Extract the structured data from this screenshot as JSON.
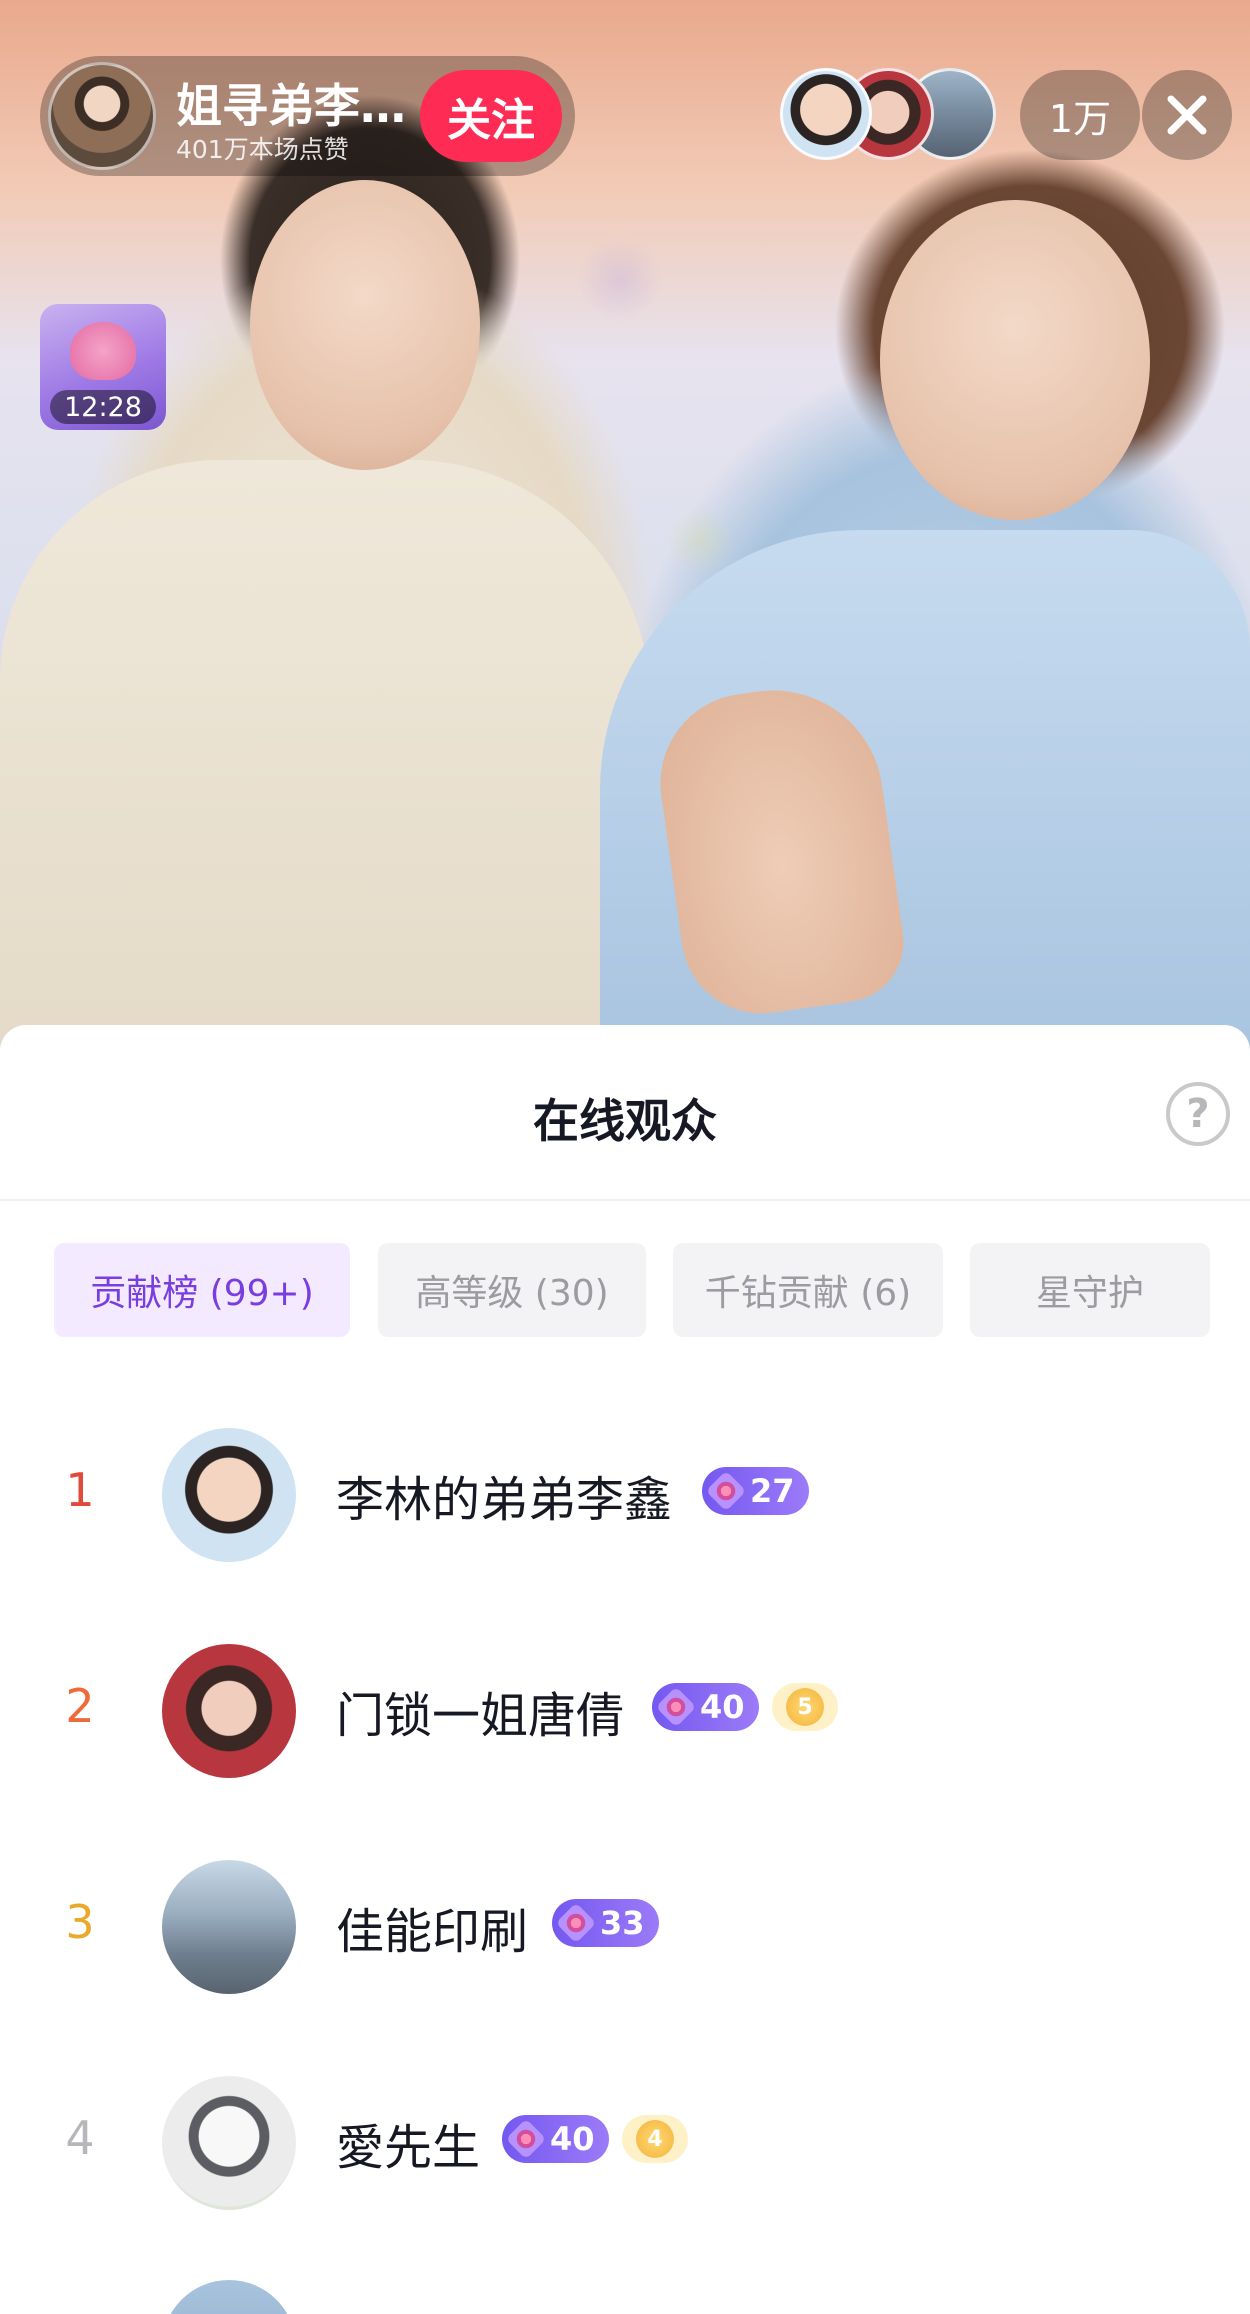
{
  "live": {
    "host_name": "姐寻弟李…",
    "likes_text": "401万本场点赞",
    "follow_label": "关注",
    "viewer_count": "1万",
    "gift_timer": "12:28"
  },
  "sheet": {
    "title": "在线观众",
    "help_symbol": "?",
    "tabs": [
      {
        "label": "贡献榜 (99+)",
        "active": true
      },
      {
        "label": "高等级 (30)",
        "active": false
      },
      {
        "label": "千钻贡献 (6)",
        "active": false
      },
      {
        "label": "星守护",
        "active": false
      }
    ],
    "rows": [
      {
        "rank": "1",
        "name": "李林的弟弟李鑫",
        "level": "27",
        "fan_level": ""
      },
      {
        "rank": "2",
        "name": "门锁一姐唐倩",
        "level": "40",
        "fan_level": "5"
      },
      {
        "rank": "3",
        "name": "佳能印刷",
        "level": "33",
        "fan_level": ""
      },
      {
        "rank": "4",
        "name": "愛先生",
        "level": "40",
        "fan_level": "4"
      }
    ]
  },
  "colors": {
    "accent": "#fe2c55",
    "tab_active_text": "#7a3ee0",
    "tab_active_bg": "#f3eaff",
    "rank1": "#e0493b",
    "rank2": "#ef6a39",
    "rank3": "#e9a92b",
    "rank_other": "#b6b6bb",
    "level_badge": "#7458f0",
    "fan_badge": "#f3b33b"
  },
  "icons": {
    "close": "close-icon",
    "help": "help-icon",
    "gift": "gift-icon",
    "level_gem": "gem-icon",
    "fan_coin": "fan-club-icon"
  }
}
